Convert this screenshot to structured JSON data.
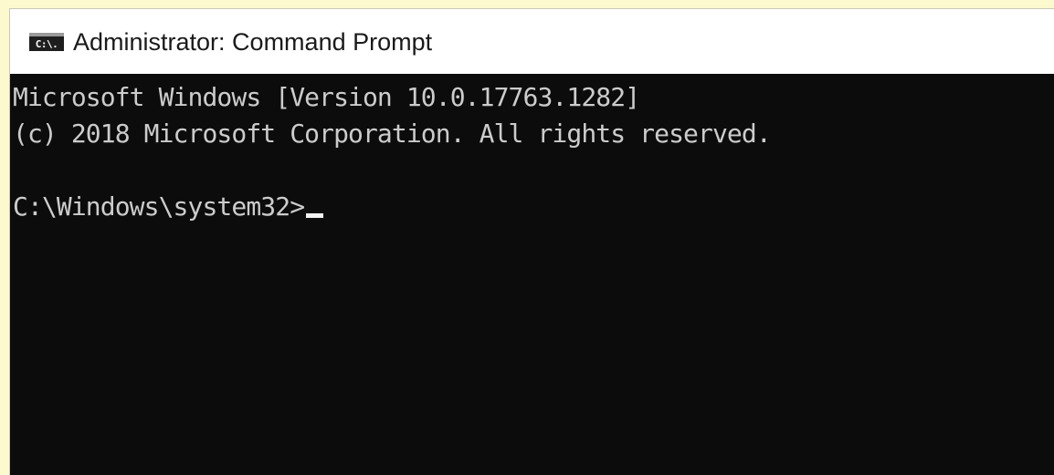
{
  "window": {
    "title": "Administrator: Command Prompt",
    "icon": "command-prompt-icon",
    "icon_glyph": "C:\\."
  },
  "console": {
    "lines": [
      "Microsoft Windows [Version 10.0.17763.1282]",
      "(c) 2018 Microsoft Corporation. All rights reserved.",
      ""
    ],
    "prompt": "C:\\Windows\\system32>",
    "input": ""
  },
  "colors": {
    "console_background": "#0c0c0c",
    "console_text": "#cccccc",
    "titlebar_background": "#ffffff",
    "desktop_background": "#fdf9cf"
  }
}
